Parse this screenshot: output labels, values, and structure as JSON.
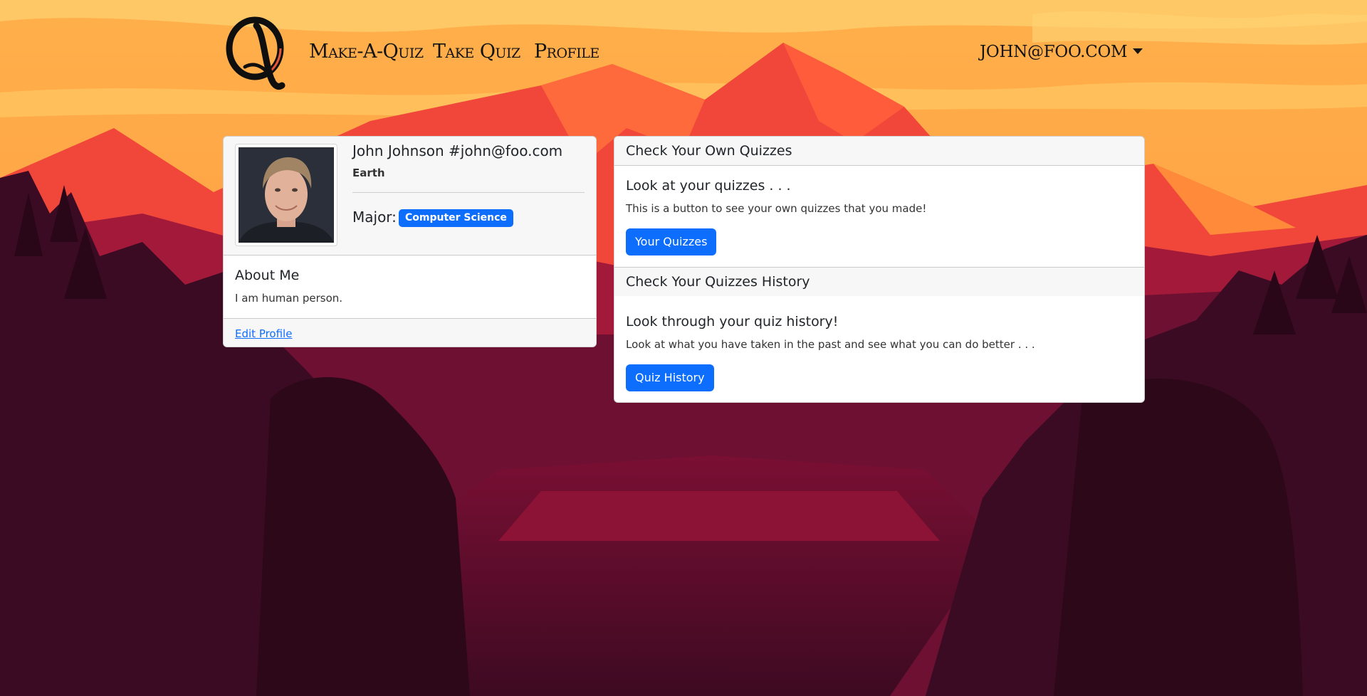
{
  "nav": {
    "links": [
      "Make-A-Quiz",
      "Take Quiz",
      "Profile"
    ],
    "user": "JOHN@FOO.COM"
  },
  "profile": {
    "name": "John Johnson #john@foo.com",
    "location": "Earth",
    "major_label": "Major:",
    "major": "Computer Science",
    "about_title": "About Me",
    "about_text": "I am human person.",
    "edit_link": "Edit Profile"
  },
  "quizzes": {
    "own": {
      "header": "Check Your Own Quizzes",
      "title": "Look at your quizzes . . .",
      "text": "This is a button to see your own quizzes that you made!",
      "button": "Your Quizzes"
    },
    "history": {
      "header": "Check Your Quizzes History",
      "title": "Look through your quiz history!",
      "text": "Look at what you have taken in the past and see what you can do better . . .",
      "button": "Quiz History"
    }
  },
  "colors": {
    "primary": "#0d6efd",
    "sky": "#fdb150",
    "mountain": "#f04a3a",
    "forest": "#3a0b22"
  },
  "icons": {
    "logo": "quiz-q-logo",
    "dropdown": "caret-down-icon"
  }
}
